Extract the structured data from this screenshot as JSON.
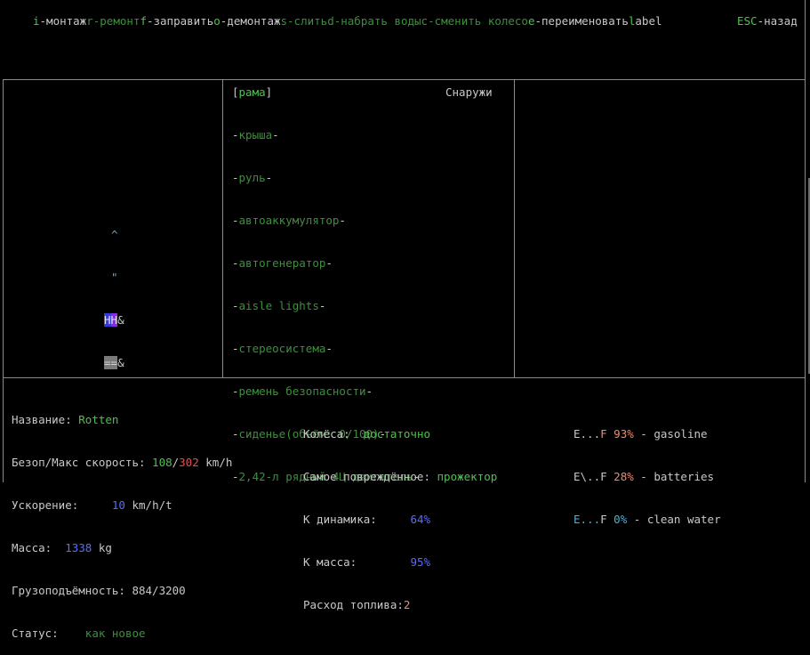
{
  "keybar": {
    "items": [
      {
        "key": "i",
        "label": "-монтаж"
      },
      {
        "key": "r",
        "label": "-ремонт"
      },
      {
        "key": "f",
        "label": "-заправить"
      },
      {
        "key": "o",
        "label": "-демонтаж"
      },
      {
        "key": "s",
        "label": "-слить"
      },
      {
        "key": "d",
        "label": "-набрать водыс-сменить колесо"
      },
      {
        "key": "e",
        "label": "-переименовать"
      },
      {
        "key": "l",
        "label": "abel"
      }
    ],
    "esc_key": "ESC",
    "esc_label": "-назад"
  },
  "vehicle_map": {
    "row1": "^",
    "row2": "\"",
    "row3a": "H",
    "row3b": "H",
    "row3c": "&",
    "row4a": "=",
    "row4b": "=",
    "row4c": "&"
  },
  "parts": {
    "header_open": "[",
    "header_name": "рама",
    "header_close": "]",
    "location": "Снаружи",
    "items": [
      "крыша",
      "руль",
      "автоаккумулятор",
      "автогенератор",
      "aisle lights",
      "стереосистема",
      "ремень безопасности",
      "сиденье(объём: 0/100)",
      "2,42-л рядный 4Ц двигатель"
    ]
  },
  "stats": {
    "name_label": "Название:",
    "name_value": "Rotten",
    "speed_label": "Безоп/Макс скорость:",
    "speed_safe": "108",
    "speed_sep": "/",
    "speed_max": "302",
    "speed_unit": "km/h",
    "accel_label": "Ускорение:",
    "accel_value": "10",
    "accel_unit": "km/h/t",
    "mass_label": "Масса:",
    "mass_value": "1338",
    "mass_unit": "kg",
    "cargo_label": "Грузоподъёмность:",
    "cargo_value": "884/3200",
    "status_label": "Статус:",
    "status_value": "как новое",
    "wheels_label": "Колёса:",
    "wheels_value": "достаточно",
    "damaged_label": "Самое повреждённое:",
    "damaged_value": "прожектор",
    "k_dyn_label": "К динамика:",
    "k_dyn_value": "64%",
    "k_mass_label": "К масса:",
    "k_mass_value": "95%",
    "fuel_use_label": "Расход топлива:",
    "fuel_use_value": "2"
  },
  "fuel": [
    {
      "gauge_a": "E...",
      "gauge_b": "F",
      "percent": "93%",
      "name": "- gasoline"
    },
    {
      "gauge_a": "E\\..",
      "gauge_b": "F",
      "percent": "28%",
      "name": "- batteries"
    },
    {
      "gauge_a": "E...",
      "gauge_b": "F",
      "percent": "0%",
      "name": "- clean water"
    }
  ],
  "colors": {
    "background": "#000000",
    "border": "#8a8a8a",
    "key_green": "#4ec24e",
    "dim_green": "#3d8f3d",
    "red": "#e05050",
    "blue": "#5a6cff",
    "cyan": "#4fb0d8"
  }
}
